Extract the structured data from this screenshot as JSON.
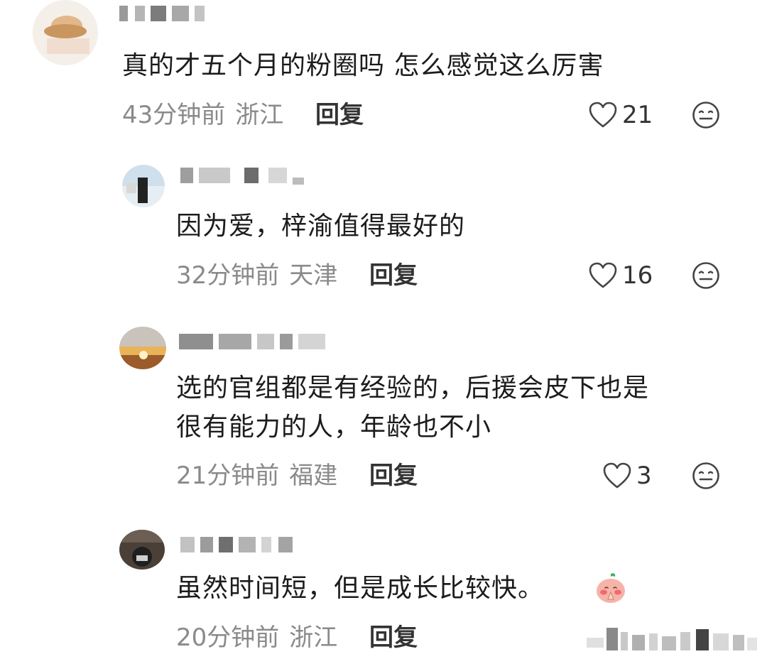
{
  "comments": [
    {
      "text": [
        "真的才五个月的粉圈吗 怎么感觉这么厉害"
      ],
      "time": "43分钟前",
      "location": "浙江",
      "reply": "回复",
      "likes": "21",
      "like_icon": "heart-outline-icon",
      "dislike_icon": "neutral-face-icon"
    },
    {
      "text": [
        "因为爱，梓渝值得最好的"
      ],
      "time": "32分钟前",
      "location": "天津",
      "reply": "回复",
      "likes": "16",
      "like_icon": "heart-outline-icon",
      "dislike_icon": "neutral-face-icon"
    },
    {
      "text": [
        "选的官组都是有经验的，后援会皮下也是",
        "很有能力的人，年龄也不小"
      ],
      "time": "21分钟前",
      "location": "福建",
      "reply": "回复",
      "likes": "3",
      "like_icon": "heart-outline-icon",
      "dislike_icon": "neutral-face-icon"
    },
    {
      "text": [
        "虽然时间短，但是成长比较快。"
      ],
      "time": "20分钟前",
      "location": "浙江",
      "reply": "回复",
      "emoji": "peach-pray-emoji-icon"
    }
  ],
  "colors": {
    "meta_text": "#8a8a8a",
    "body_text": "#1c1c1c",
    "icon_stroke": "#444444"
  }
}
